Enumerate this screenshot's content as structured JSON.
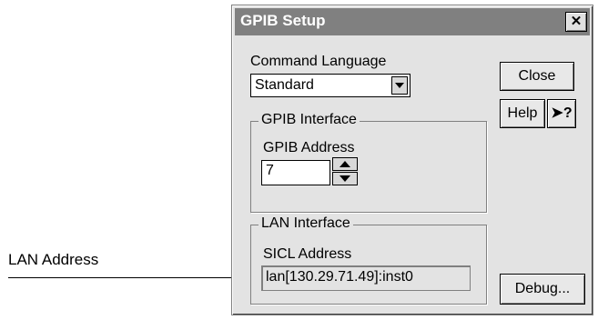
{
  "callout": {
    "label": "LAN Address"
  },
  "dialog": {
    "title": "GPIB Setup",
    "close_glyph": "✕",
    "command_language": {
      "label": "Command Language",
      "value": "Standard"
    },
    "gpib_interface": {
      "group_title": "GPIB Interface",
      "address_label": "GPIB Address",
      "address_value": "7"
    },
    "lan_interface": {
      "group_title": "LAN Interface",
      "sicl_label": "SICL Address",
      "sicl_value": "lan[130.29.71.49]:inst0"
    },
    "buttons": {
      "close": "Close",
      "help": "Help",
      "whats_this": "?",
      "debug": "Debug..."
    }
  }
}
